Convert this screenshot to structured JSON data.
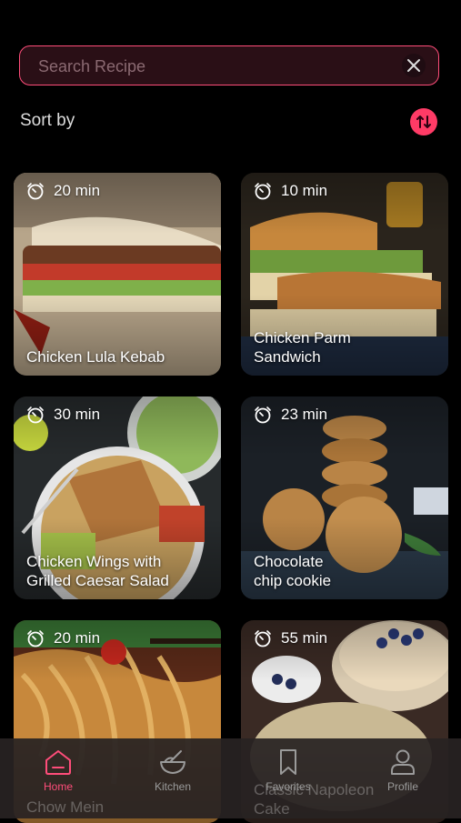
{
  "search": {
    "placeholder": "Search Recipe"
  },
  "sort": {
    "label": "Sort by"
  },
  "recipes": [
    {
      "time": "20 min",
      "title": "Chicken Lula Kebab"
    },
    {
      "time": "10 min",
      "title": "Chicken Parm\nSandwich"
    },
    {
      "time": "30 min",
      "title": "Chicken Wings with\nGrilled Caesar Salad"
    },
    {
      "time": "23 min",
      "title": "Chocolate\nchip cookie"
    },
    {
      "time": "20 min",
      "title": "Chow Mein"
    },
    {
      "time": "55 min",
      "title": "Classic Napoleon\nCake"
    }
  ],
  "nav": [
    {
      "label": "Home"
    },
    {
      "label": "Kitchen"
    },
    {
      "label": "Favorites"
    },
    {
      "label": "Profile"
    }
  ],
  "colors": {
    "accent": "#ff3b66",
    "background": "#000000"
  }
}
